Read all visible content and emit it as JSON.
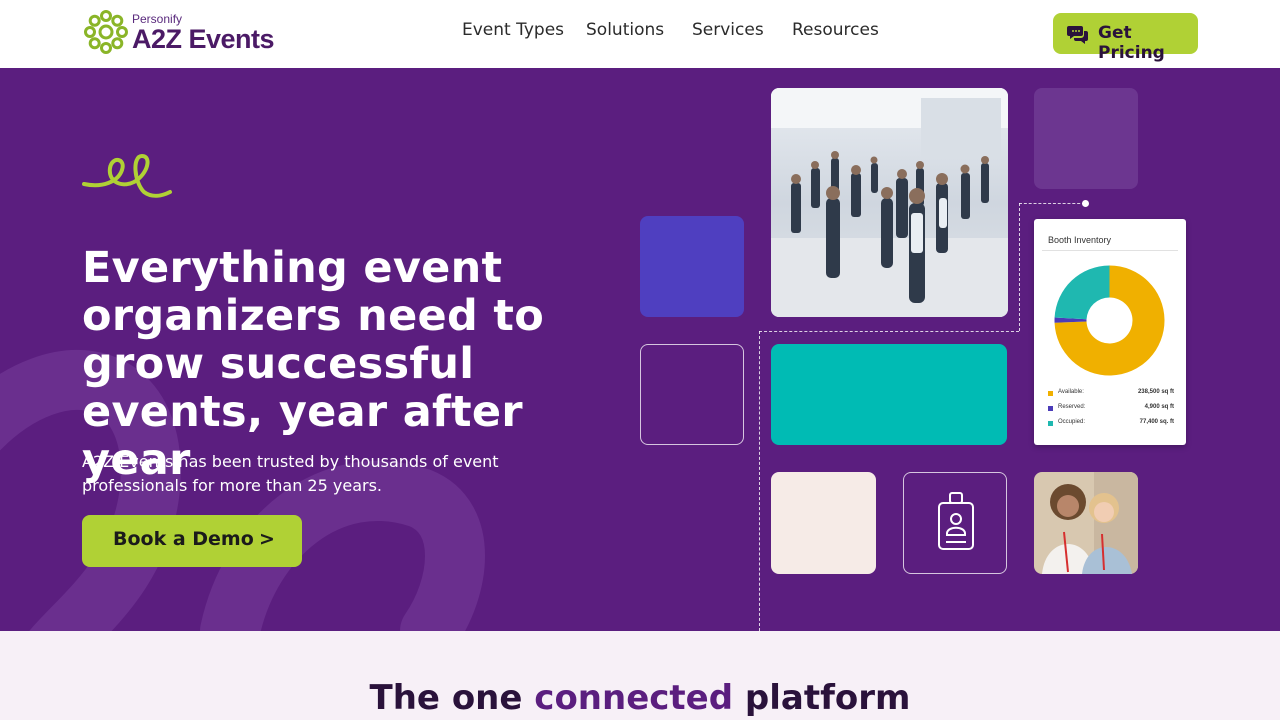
{
  "header": {
    "logo_brand": "Personify",
    "logo_name": "A2Z Events",
    "nav": [
      "Event Types",
      "Solutions",
      "Services",
      "Resources"
    ],
    "cta_label": "Get Pricing"
  },
  "hero": {
    "title": "Everything event organizers need to grow successful events, year after year",
    "subtitle": "A2Z Events has been trusted by thousands of event professionals for more than 25 years.",
    "demo_label": "Book a Demo",
    "demo_arrow": ">"
  },
  "booth": {
    "title": "Booth Inventory",
    "items": [
      {
        "label": "Available:",
        "value": "238,500 sq ft",
        "color": "#f0b000",
        "amount": 238500
      },
      {
        "label": "Reserved:",
        "value": "4,900 sq ft",
        "color": "#4b3bb8",
        "amount": 4900
      },
      {
        "label": "Occupied:",
        "value": "77,400 sq. ft",
        "color": "#1fb8b0",
        "amount": 77400
      }
    ]
  },
  "band": {
    "title_pre": "The one ",
    "title_highlight": "connected",
    "title_post": " platform"
  },
  "colors": {
    "brand_purple": "#5b1e7f",
    "accent_green": "#b0d135",
    "teal": "#00bbb4",
    "blue": "#4f3fc0"
  },
  "icons": [
    "logo-flower-icon",
    "chat-bubbles-icon",
    "squiggle-icon",
    "id-badge-icon"
  ]
}
